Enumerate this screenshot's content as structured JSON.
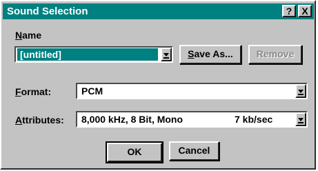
{
  "window": {
    "title": "Sound Selection",
    "help_label": "?",
    "close_label": "X",
    "colors": {
      "titlebar": "#008080",
      "face": "#c3c3c3"
    }
  },
  "name": {
    "label_first": "N",
    "label_rest": "ame",
    "value": "[untitled]",
    "save_as_first": "S",
    "save_as_rest": "ave As...",
    "remove_label": "Remove"
  },
  "format": {
    "label_first": "F",
    "label_rest": "ormat:",
    "value": "PCM"
  },
  "attributes": {
    "label_first": "A",
    "label_rest": "ttributes:",
    "value": "8,000 kHz, 8 Bit, Mono",
    "rate": "7 kb/sec"
  },
  "buttons": {
    "ok": "OK",
    "cancel": "Cancel"
  },
  "icons": [
    "help-icon",
    "close-icon",
    "dropdown-arrow-icon"
  ]
}
